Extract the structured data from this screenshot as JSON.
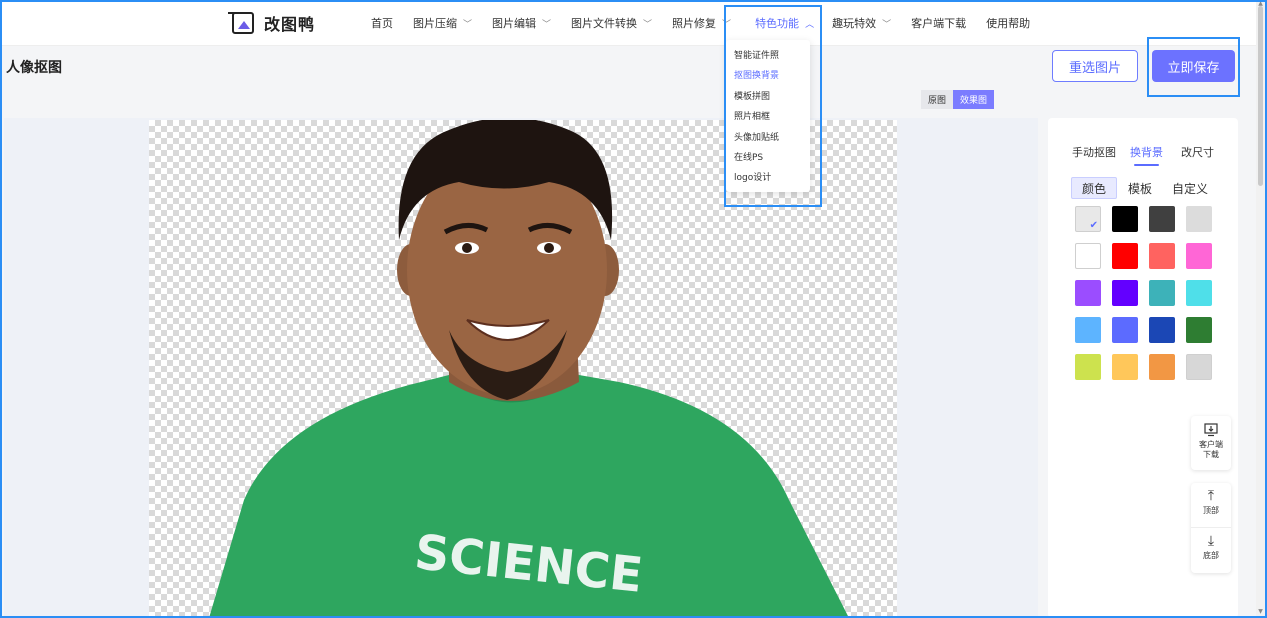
{
  "app": {
    "name": "改图鸭",
    "logo_icon": "logo-icon"
  },
  "nav": {
    "items": [
      {
        "label": "首页",
        "has_chevron": false
      },
      {
        "label": "图片压缩",
        "has_chevron": true
      },
      {
        "label": "图片编辑",
        "has_chevron": true
      },
      {
        "label": "图片文件转换",
        "has_chevron": true
      },
      {
        "label": "照片修复",
        "has_chevron": true
      },
      {
        "label": "特色功能",
        "has_chevron": true,
        "active": true
      },
      {
        "label": "趣玩特效",
        "has_chevron": true
      },
      {
        "label": "客户端下载",
        "has_chevron": false
      },
      {
        "label": "使用帮助",
        "has_chevron": false
      }
    ],
    "dropdown": [
      {
        "label": "智能证件照"
      },
      {
        "label": "抠图换背景",
        "active": true
      },
      {
        "label": "模板拼图"
      },
      {
        "label": "照片相框"
      },
      {
        "label": "头像加贴纸"
      },
      {
        "label": "在线PS"
      },
      {
        "label": "logo设计"
      }
    ]
  },
  "page": {
    "title": "人像抠图",
    "reselect_label": "重选图片",
    "save_label": "立即保存",
    "view_toggle": {
      "original": "原图",
      "result": "效果图",
      "selected": "效果图"
    }
  },
  "canvas": {
    "shirt_text": "SCIENCE",
    "shirt_color": "#2ea65f",
    "background": "transparent-checkerboard"
  },
  "panel": {
    "tabs": [
      {
        "label": "手动抠图"
      },
      {
        "label": "换背景",
        "active": true
      },
      {
        "label": "改尺寸"
      }
    ],
    "subtabs": [
      {
        "label": "颜色",
        "active": true
      },
      {
        "label": "模板"
      },
      {
        "label": "自定义"
      }
    ],
    "swatches": [
      "#e8e8e8",
      "#000000",
      "#404040",
      "#dcdcdc",
      "#ffffff",
      "#ff0000",
      "#ff6360",
      "#ff66d6",
      "#9b4dff",
      "#6300ff",
      "#3db2b9",
      "#4fdfe9",
      "#5db4ff",
      "#5c6bff",
      "#1b47b5",
      "#2e7d32",
      "#cde24e",
      "#ffc75a",
      "#f29744",
      "#d7d7d7"
    ],
    "selected_swatch": 0
  },
  "side_tools": {
    "download": {
      "label_line1": "客户端",
      "label_line2": "下载",
      "icon": "monitor-download-icon"
    },
    "top": {
      "label": "顶部",
      "icon": "arrow-up-icon"
    },
    "bottom": {
      "label": "底部",
      "icon": "arrow-down-icon"
    }
  },
  "colors": {
    "accent": "#5b6cff",
    "highlight": "#2b8ef5"
  }
}
